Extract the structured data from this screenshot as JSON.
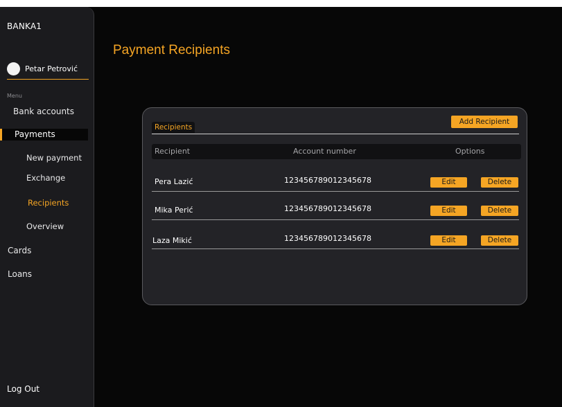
{
  "sidebar": {
    "brand": "BANKA1",
    "user_name": "Petar Petrović",
    "menu_label": "Menu",
    "items": {
      "bank_accounts": "Bank accounts",
      "payments": "Payments",
      "new_payment": "New payment",
      "exchange": "Exchange",
      "recipients": "Recipients",
      "overview": "Overview",
      "cards": "Cards",
      "loans": "Loans"
    },
    "logout": "Log Out"
  },
  "main": {
    "title": "Payment Recipients",
    "tab": "Recipients",
    "add_button": "Add Recipient",
    "columns": [
      "Recipient",
      "Account number",
      "Options"
    ],
    "rows": [
      {
        "name": "Pera Lazić",
        "account": "123456789012345678",
        "edit": "Edit",
        "delete": "Delete"
      },
      {
        "name": "Mika Perić",
        "account": "123456789012345678",
        "edit": "Edit",
        "delete": "Delete"
      },
      {
        "name": "Laza Mikić",
        "account": "123456789012345678",
        "edit": "Edit",
        "delete": "Delete"
      }
    ]
  },
  "colors": {
    "accent": "#f5a524",
    "background": "#070707",
    "sidebar": "#1b1b1e",
    "card": "#232327"
  }
}
